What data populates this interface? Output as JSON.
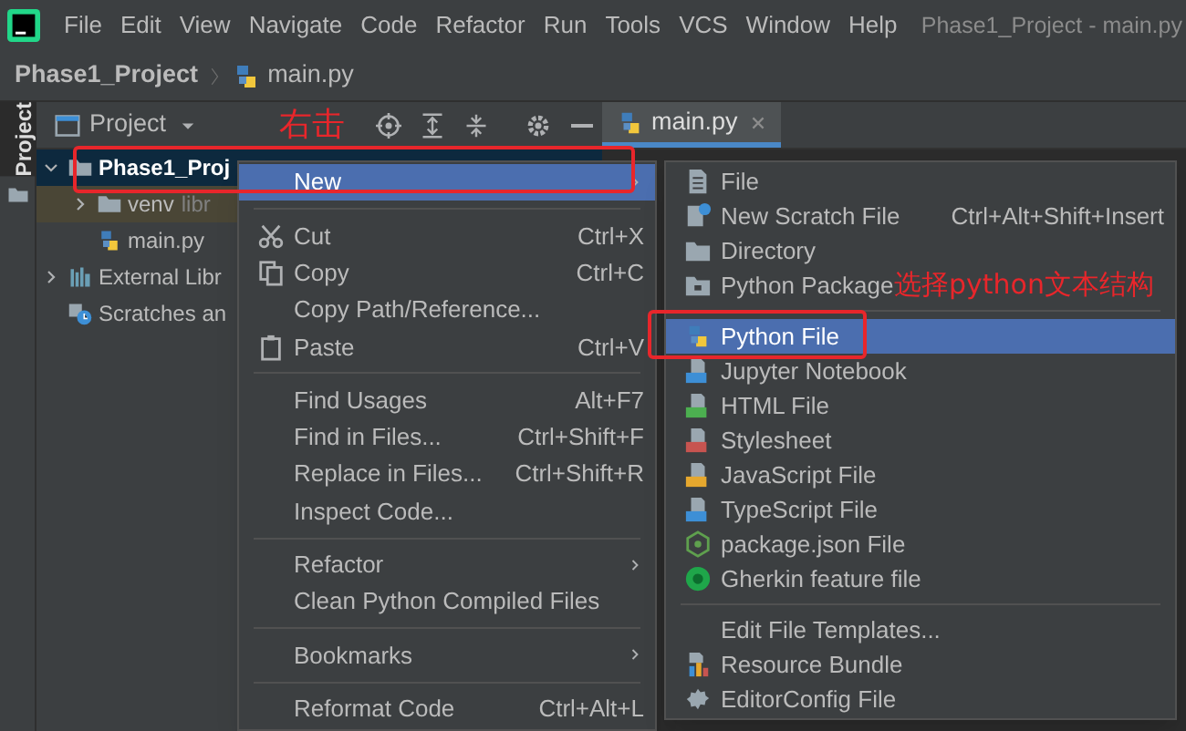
{
  "menubar": {
    "items": [
      "File",
      "Edit",
      "View",
      "Navigate",
      "Code",
      "Refactor",
      "Run",
      "Tools",
      "VCS",
      "Window",
      "Help"
    ],
    "title": "Phase1_Project - main.py"
  },
  "breadcrumb": [
    "Phase1_Project",
    "main.py"
  ],
  "tool_stripe": {
    "tab": "Project",
    "selected": true
  },
  "project_panel": {
    "title": "Project",
    "tree": [
      {
        "label": "Phase1_Proj",
        "selected": true,
        "expanded": true,
        "children": [
          {
            "label": "venv",
            "note": "libr",
            "selected": false,
            "highlighted": true,
            "expanded": false
          },
          {
            "label": "main.py",
            "selected": false
          }
        ]
      },
      {
        "label": "External Libr",
        "selected": false,
        "expanded": false
      },
      {
        "label": "Scratches an",
        "selected": false
      }
    ]
  },
  "editor_tabs": [
    {
      "label": "main.py",
      "selected": true
    }
  ],
  "context_menu": {
    "items": [
      {
        "kind": "item",
        "label": "New",
        "submenu": true,
        "selected": true
      },
      {
        "kind": "separator"
      },
      {
        "kind": "item",
        "label": "Cut",
        "shortcut": "Ctrl+X",
        "selected": false
      },
      {
        "kind": "item",
        "label": "Copy",
        "shortcut": "Ctrl+C",
        "selected": false
      },
      {
        "kind": "item",
        "label": "Copy Path/Reference...",
        "selected": false
      },
      {
        "kind": "item",
        "label": "Paste",
        "shortcut": "Ctrl+V",
        "selected": false
      },
      {
        "kind": "separator"
      },
      {
        "kind": "item",
        "label": "Find Usages",
        "shortcut": "Alt+F7",
        "selected": false
      },
      {
        "kind": "item",
        "label": "Find in Files...",
        "shortcut": "Ctrl+Shift+F",
        "selected": false
      },
      {
        "kind": "item",
        "label": "Replace in Files...",
        "shortcut": "Ctrl+Shift+R",
        "selected": false
      },
      {
        "kind": "item",
        "label": "Inspect Code...",
        "selected": false
      },
      {
        "kind": "separator"
      },
      {
        "kind": "item",
        "label": "Refactor",
        "submenu": true,
        "selected": false
      },
      {
        "kind": "item",
        "label": "Clean Python Compiled Files",
        "selected": false
      },
      {
        "kind": "separator"
      },
      {
        "kind": "item",
        "label": "Bookmarks",
        "submenu": true,
        "selected": false
      },
      {
        "kind": "separator"
      },
      {
        "kind": "item",
        "label": "Reformat Code",
        "shortcut": "Ctrl+Alt+L",
        "selected": false
      }
    ]
  },
  "new_submenu": {
    "items": [
      {
        "kind": "item",
        "label": "File",
        "selected": false
      },
      {
        "kind": "item",
        "label": "New Scratch File",
        "shortcut": "Ctrl+Alt+Shift+Insert",
        "selected": false
      },
      {
        "kind": "item",
        "label": "Directory",
        "selected": false
      },
      {
        "kind": "item",
        "label": "Python Package",
        "selected": false
      },
      {
        "kind": "separator"
      },
      {
        "kind": "item",
        "label": "Python File",
        "selected": true
      },
      {
        "kind": "item",
        "label": "Jupyter Notebook",
        "selected": false
      },
      {
        "kind": "item",
        "label": "HTML File",
        "selected": false
      },
      {
        "kind": "item",
        "label": "Stylesheet",
        "selected": false
      },
      {
        "kind": "item",
        "label": "JavaScript File",
        "selected": false
      },
      {
        "kind": "item",
        "label": "TypeScript File",
        "selected": false
      },
      {
        "kind": "item",
        "label": "package.json File",
        "selected": false
      },
      {
        "kind": "item",
        "label": "Gherkin feature file",
        "selected": false
      },
      {
        "kind": "separator"
      },
      {
        "kind": "item",
        "label": "Edit File Templates...",
        "selected": false
      },
      {
        "kind": "item",
        "label": "Resource Bundle",
        "selected": false
      },
      {
        "kind": "item",
        "label": "EditorConfig File",
        "selected": false
      }
    ]
  },
  "annotations": [
    {
      "kind": "text",
      "text": "右击"
    },
    {
      "kind": "box"
    },
    {
      "kind": "text",
      "text": "选择python文本结构"
    },
    {
      "kind": "box"
    }
  ]
}
